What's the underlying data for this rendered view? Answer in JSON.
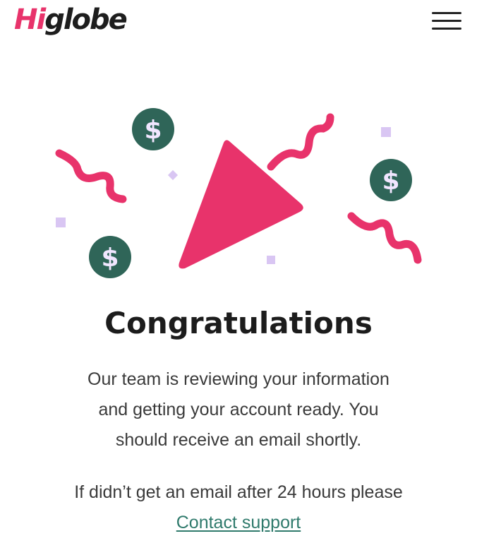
{
  "header": {
    "logo_prefix": "Hi",
    "logo_suffix": "globe",
    "menu_icon": "hamburger-menu-icon"
  },
  "illustration": {
    "center_icon": "party-popper-triangle-icon",
    "coin_icon": "dollar-coin-icon",
    "coin_symbol": "$",
    "colors": {
      "accent": "#e8336b",
      "coin": "#2f6558",
      "coin_symbol": "#f1e6ff",
      "confetti": "#d9c6f3"
    }
  },
  "main": {
    "title": "Congratulations",
    "message_lines": [
      "Our team is reviewing your information",
      "and getting your account ready. You",
      "should receive an email shortly."
    ],
    "help_text": "If didn’t get an email after 24 hours please",
    "contact_link": "Contact support"
  },
  "colors": {
    "brand_pink": "#e8336b",
    "link": "#2f7a6c",
    "text": "#3a3a3a",
    "title": "#1c1c1c"
  }
}
